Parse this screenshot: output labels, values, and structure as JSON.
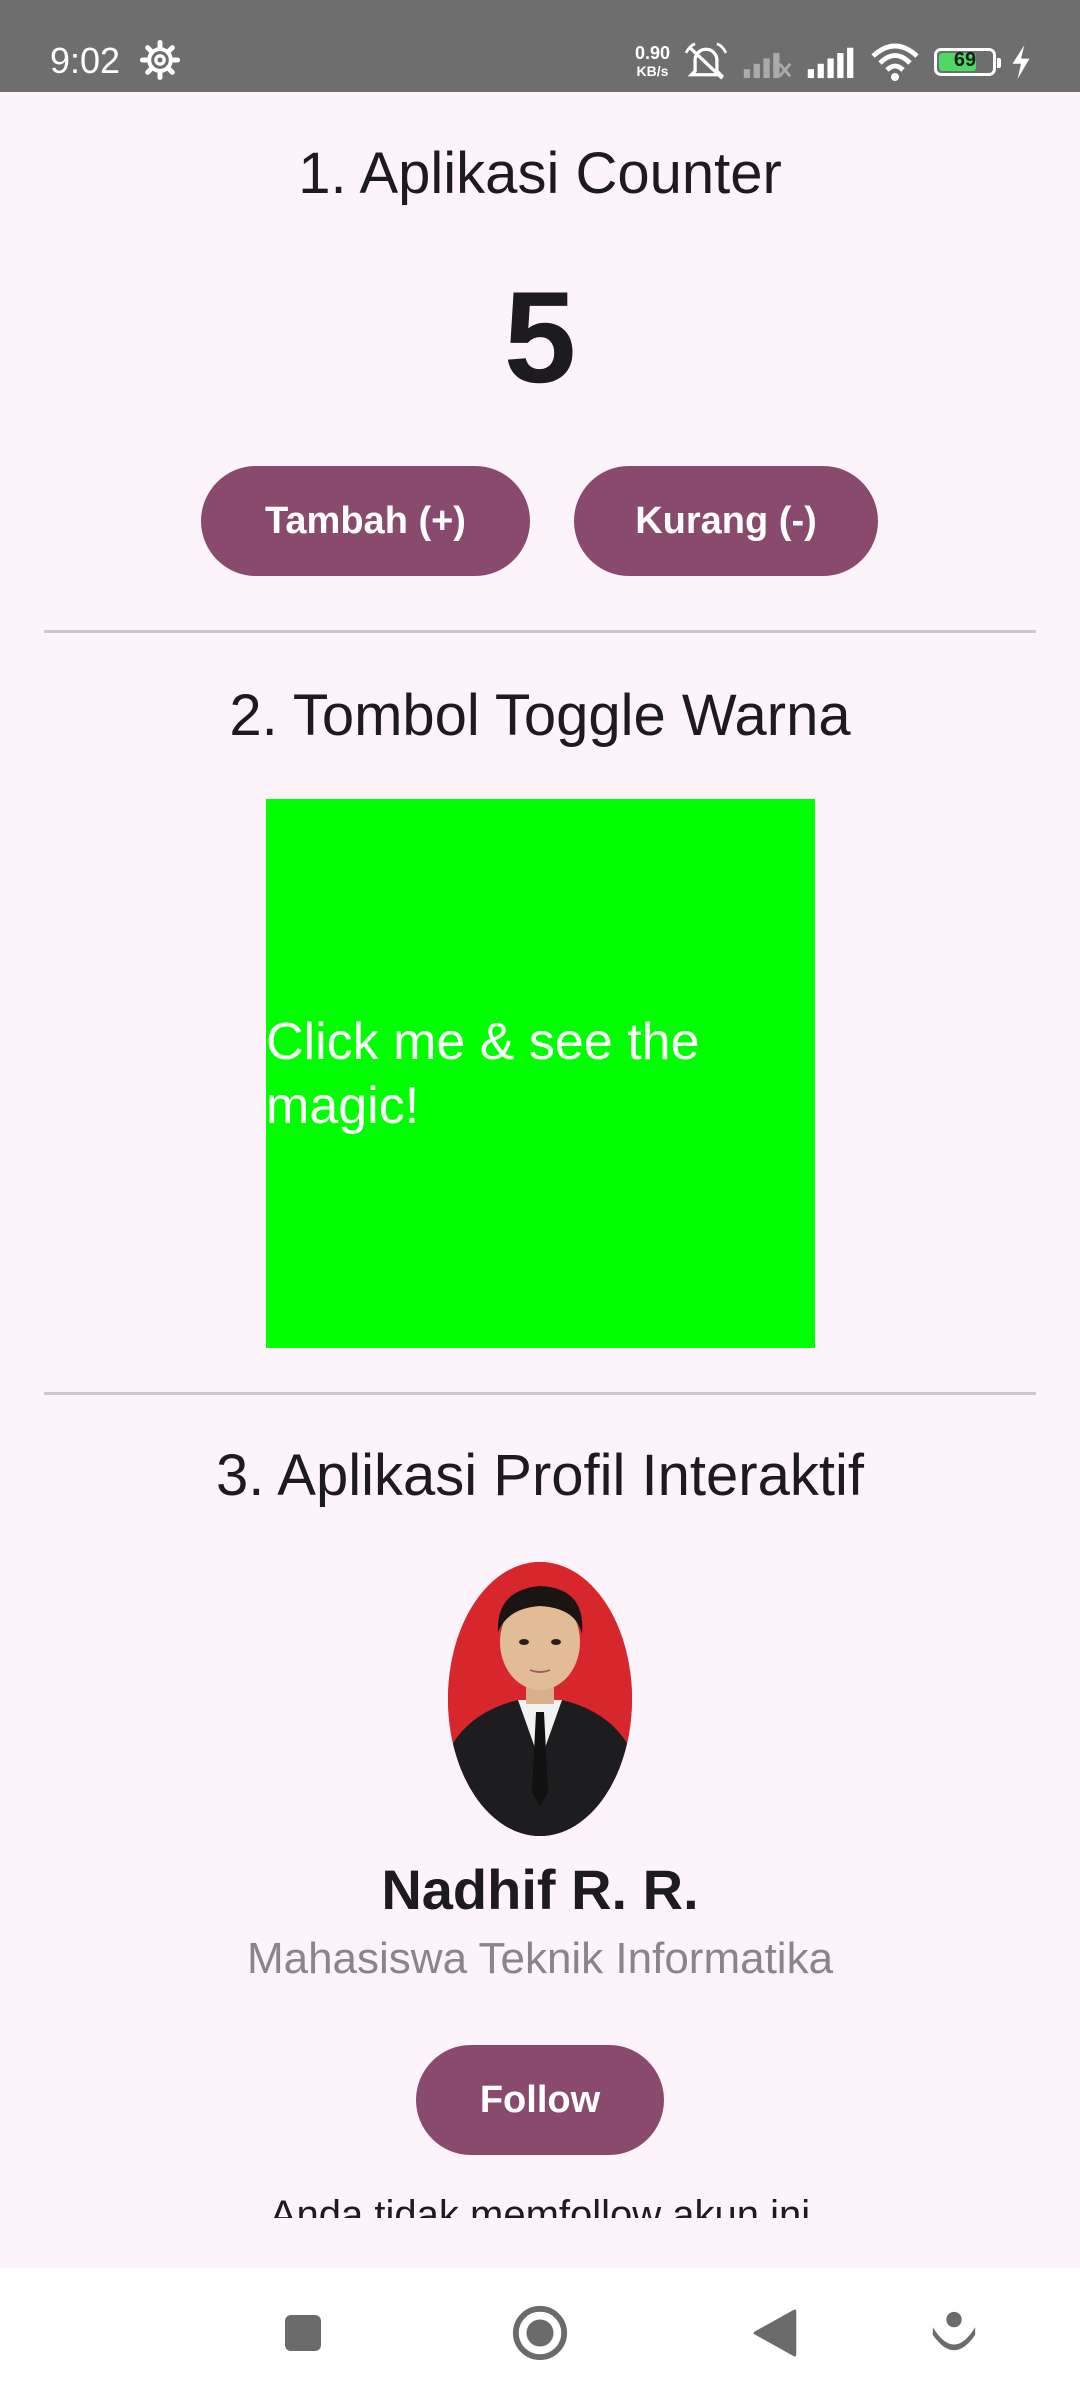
{
  "status_bar": {
    "time": "9:02",
    "net_speed": "0.90",
    "net_speed_unit": "KB/s",
    "battery_level": "69",
    "battery_color": "#4cd964",
    "icons": [
      "settings-gear-icon",
      "alarm-off-icon",
      "signal-sim2-icon",
      "signal-sim1-icon",
      "wifi-icon",
      "battery-icon",
      "charging-icon"
    ]
  },
  "counter_section": {
    "title": "1. Aplikasi Counter",
    "value": "5",
    "increment_label": "Tambah (+)",
    "decrement_label": "Kurang (-)"
  },
  "toggle_section": {
    "title": "2. Tombol Toggle Warna",
    "box_label": "Click me & see the magic!",
    "box_color": "#00ff00"
  },
  "profile_section": {
    "title": "3. Aplikasi Profil Interaktif",
    "name": "Nadhif R. R.",
    "subtitle": "Mahasiswa Teknik Informatika",
    "follow_label": "Follow",
    "follow_status": "Anda tidak memfollow akun ini"
  },
  "colors": {
    "background": "#fdf3fa",
    "button": "#8a4a6e",
    "status_bar": "#6e6e6e"
  },
  "nav_bar": {
    "icons": [
      "recent-apps-icon",
      "home-icon",
      "back-icon",
      "assistant-icon"
    ]
  }
}
